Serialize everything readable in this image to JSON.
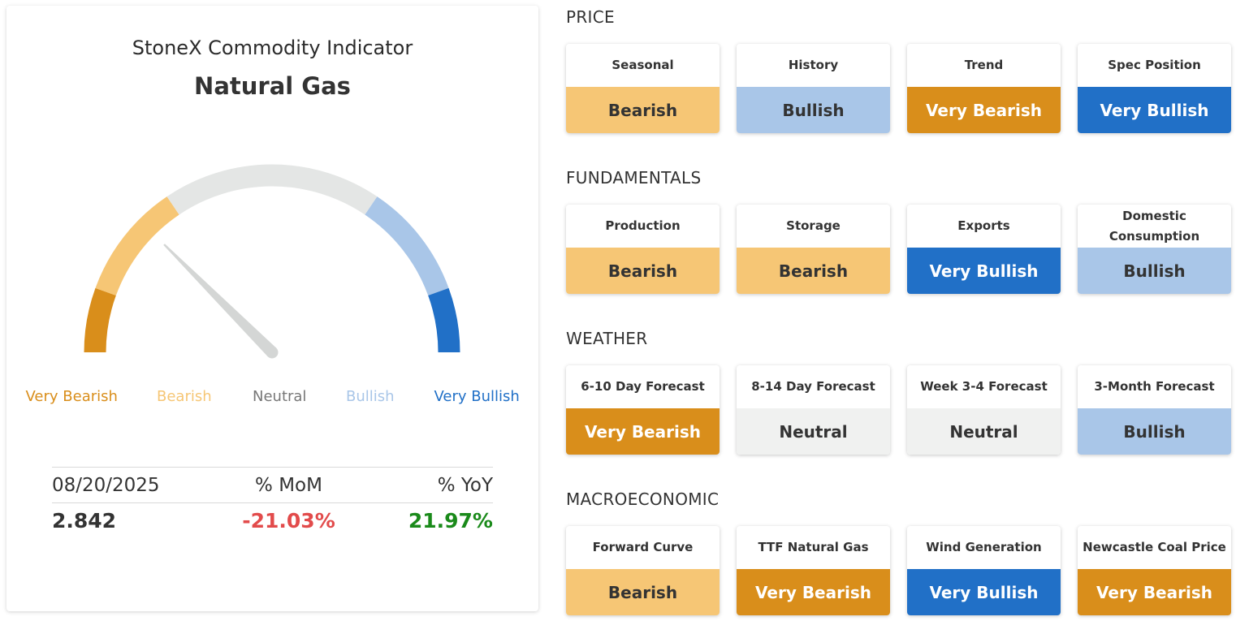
{
  "indicator": {
    "title": "StoneX Commodity Indicator",
    "commodity": "Natural Gas",
    "needle_level": 0.25
  },
  "gauge": {
    "legend": [
      {
        "label": "Very Bearish",
        "color": "#d98e1b"
      },
      {
        "label": "Bearish",
        "color": "#f6c675"
      },
      {
        "label": "Neutral",
        "color": "#777777"
      },
      {
        "label": "Bullish",
        "color": "#a9c6e8"
      },
      {
        "label": "Very Bullish",
        "color": "#2170c7"
      }
    ],
    "track_color": "#e4e6e5",
    "needle_color": "#d4d6d5"
  },
  "stats": {
    "date": "08/20/2025",
    "mom_label": "% MoM",
    "yoy_label": "% YoY",
    "price": "2.842",
    "mom_value": "-21.03%",
    "yoy_value": "21.97%",
    "mom_color": "#e24b4b",
    "yoy_color": "#1a8a1a"
  },
  "status_styles": {
    "Very Bearish": {
      "bg": "#d98e1b",
      "fg": "#ffffff"
    },
    "Bearish": {
      "bg": "#f6c675",
      "fg": "#333333"
    },
    "Neutral": {
      "bg": "#f0f1f0",
      "fg": "#333333"
    },
    "Bullish": {
      "bg": "#a9c6e8",
      "fg": "#333333"
    },
    "Very Bullish": {
      "bg": "#2170c7",
      "fg": "#ffffff"
    }
  },
  "sections": [
    {
      "title": "PRICE",
      "tiles": [
        {
          "label": "Seasonal",
          "value": "Bearish"
        },
        {
          "label": "History",
          "value": "Bullish"
        },
        {
          "label": "Trend",
          "value": "Very Bearish"
        },
        {
          "label": "Spec Position",
          "value": "Very Bullish"
        }
      ]
    },
    {
      "title": "FUNDAMENTALS",
      "tiles": [
        {
          "label": "Production",
          "value": "Bearish"
        },
        {
          "label": "Storage",
          "value": "Bearish"
        },
        {
          "label": "Exports",
          "value": "Very Bullish"
        },
        {
          "label": "Domestic Consumption",
          "value": "Bullish"
        }
      ]
    },
    {
      "title": "WEATHER",
      "tiles": [
        {
          "label": "6-10 Day Forecast",
          "value": "Very Bearish"
        },
        {
          "label": "8-14 Day Forecast",
          "value": "Neutral"
        },
        {
          "label": "Week 3-4 Forecast",
          "value": "Neutral"
        },
        {
          "label": "3-Month Forecast",
          "value": "Bullish"
        }
      ]
    },
    {
      "title": "MACROECONOMIC",
      "tiles": [
        {
          "label": "Forward Curve",
          "value": "Bearish"
        },
        {
          "label": "TTF Natural Gas",
          "value": "Very Bearish"
        },
        {
          "label": "Wind Generation",
          "value": "Very Bullish"
        },
        {
          "label": "Newcastle Coal Price",
          "value": "Very Bearish"
        }
      ]
    }
  ]
}
